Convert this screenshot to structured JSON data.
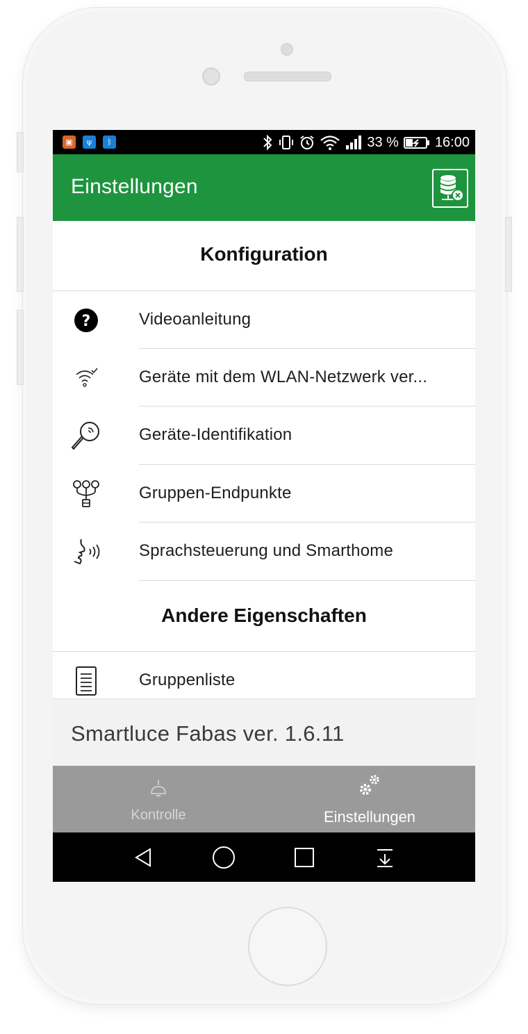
{
  "status_bar": {
    "battery_percent": "33 %",
    "time": "16:00"
  },
  "app_bar": {
    "title": "Einstellungen",
    "action_icon": "database-disconnect-icon"
  },
  "sections": [
    {
      "title": "Konfiguration",
      "items": [
        {
          "label": "Videoanleitung",
          "icon": "help-circle-icon"
        },
        {
          "label": "Geräte mit dem WLAN-Netzwerk ver...",
          "icon": "wifi-check-icon"
        },
        {
          "label": "Geräte-Identifikation",
          "icon": "magnifier-signal-icon"
        },
        {
          "label": "Gruppen-Endpunkte",
          "icon": "group-bulbs-icon"
        },
        {
          "label": "Sprachsteuerung und Smarthome",
          "icon": "voice-control-icon"
        }
      ]
    },
    {
      "title": "Andere Eigenschaften",
      "items": [
        {
          "label": "Gruppenliste",
          "icon": "document-list-icon"
        }
      ]
    }
  ],
  "version": "Smartluce Fabas ver. 1.6.11",
  "bottom_nav": {
    "tabs": [
      {
        "label": "Kontrolle",
        "icon": "ceiling-lamp-icon",
        "active": false
      },
      {
        "label": "Einstellungen",
        "icon": "gears-icon",
        "active": true
      }
    ]
  },
  "colors": {
    "app_bar": "#1e943f",
    "bottom_nav": "#9a9a9a",
    "version_bar": "#f2f2f2"
  }
}
